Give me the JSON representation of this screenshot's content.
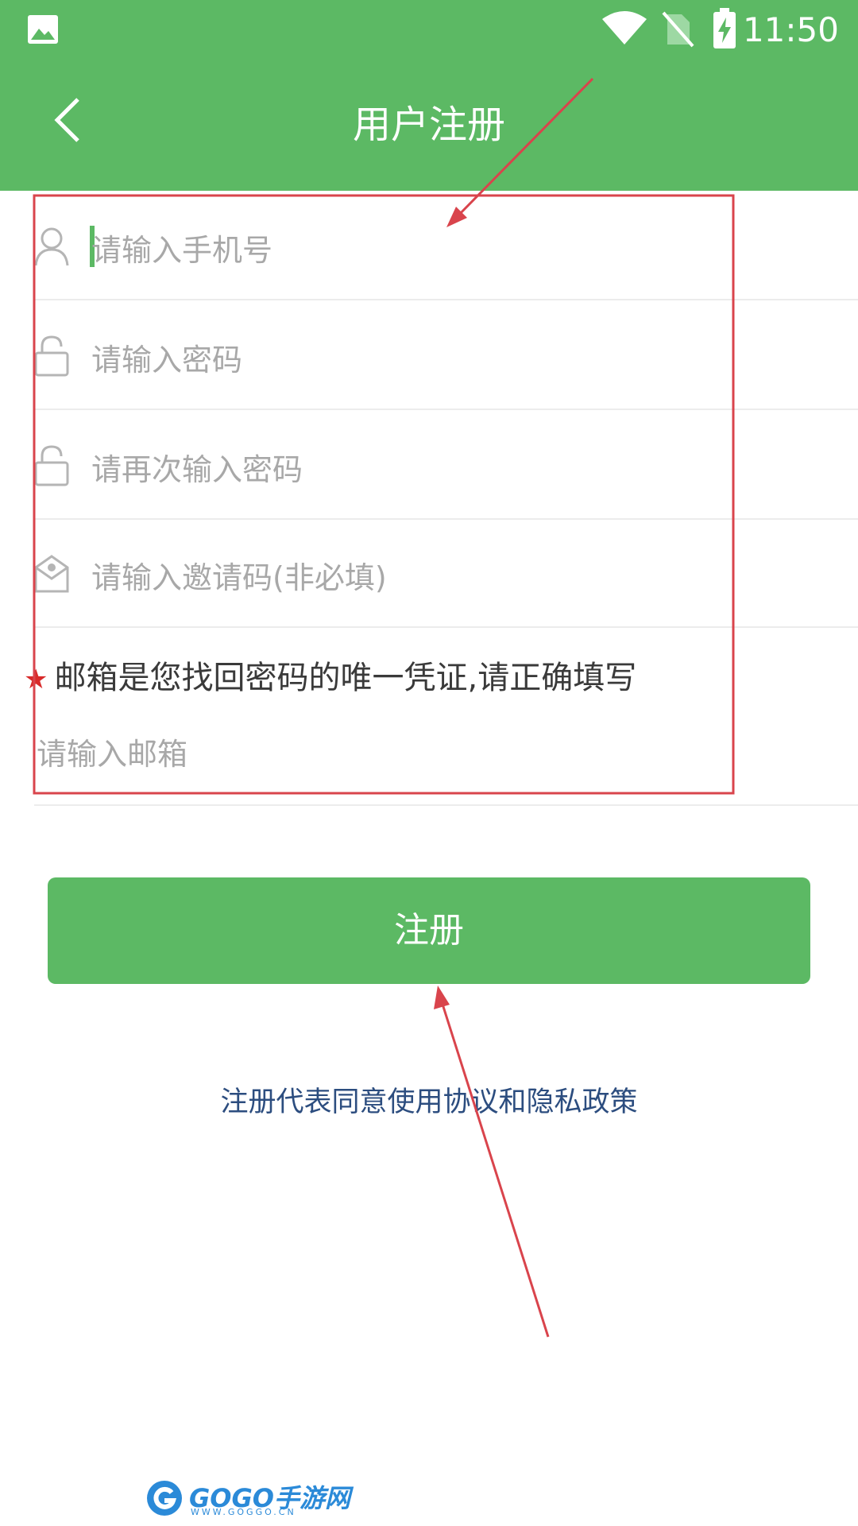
{
  "status_bar": {
    "time": "11:50",
    "icons": [
      "image-icon",
      "wifi-icon",
      "no-sim-icon",
      "battery-charging-icon"
    ]
  },
  "header": {
    "title": "用户注册",
    "back_icon": "chevron-left-icon"
  },
  "form": {
    "phone": {
      "placeholder": "请输入手机号",
      "icon": "user-icon"
    },
    "password": {
      "placeholder": "请输入密码",
      "icon": "lock-icon"
    },
    "password_confirm": {
      "placeholder": "请再次输入密码",
      "icon": "lock-icon"
    },
    "invite_code": {
      "placeholder": "请输入邀请码(非必填)",
      "icon": "invite-icon"
    },
    "email_notice": {
      "star": "★",
      "text": "邮箱是您找回密码的唯一凭证,请正确填写"
    },
    "email": {
      "placeholder": "请输入邮箱"
    }
  },
  "register_button": {
    "label": "注册"
  },
  "agreement_text": "注册代表同意使用协议和隐私政策",
  "watermark": {
    "brand": "GOGO手游网",
    "url": "WWW.GOGGO.CN"
  },
  "colors": {
    "primary": "#5cb964",
    "link": "#2c4d7f",
    "required_star": "#d82a2a",
    "annotation": "#d9444c"
  }
}
